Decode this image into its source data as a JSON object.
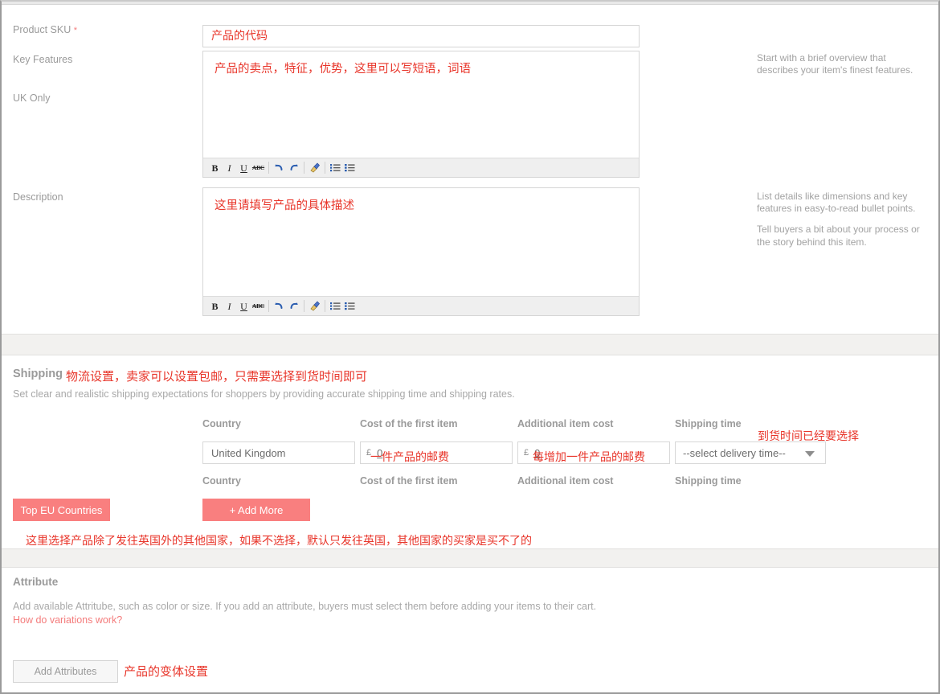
{
  "details": {
    "sku": {
      "label": "Product SKU",
      "required_mark": "*",
      "value": "",
      "placeholder": "产品的代码"
    },
    "key_features": {
      "label": "Key Features",
      "content": "产品的卖点，特征，优势，这里可以写短语，词语",
      "help": "Start with a brief overview that describes your item's finest features."
    },
    "description": {
      "label": "Description",
      "content": "这里请填写产品的具体描述",
      "help_1": "List details like dimensions and key features in easy-to-read bullet points.",
      "help_2": "Tell buyers a bit about your process or the story behind this item."
    },
    "toolbar": {
      "bold": "B",
      "italic": "I",
      "underline": "U",
      "strikethrough": "ABC",
      "undo": "↰",
      "redo": "↱",
      "format_painter": "brush",
      "bullet_list": "list",
      "numbered_list": "list"
    }
  },
  "shipping": {
    "title": "Shipping",
    "title_note": "物流设置，卖家可以设置包邮，只需要选择到货时间即可",
    "subtitle": "Set clear and realistic shipping expectations for shoppers by providing accurate shipping time and shipping rates.",
    "row_label": "UK Only",
    "columns": {
      "country": "Country",
      "first_cost": "Cost of the first item",
      "additional_cost": "Additional item cost",
      "shipping_time": "Shipping time"
    },
    "columns_2": {
      "country": "Country",
      "first_cost": "Cost of the first item",
      "additional_cost": "Additional item cost",
      "shipping_time": "Shipping time"
    },
    "values": {
      "country": "United Kingdom",
      "currency_symbol": "£",
      "first_cost": "0",
      "additional_cost": "0",
      "shipping_time": "--select delivery time--"
    },
    "buttons": {
      "top_eu": "Top EU Countries",
      "add_more": "+ Add More"
    },
    "notes": {
      "shipping_time": "到货时间已经要选择",
      "first_cost": "一件产品的邮费",
      "additional_cost": "每增加一件产品的邮费",
      "countries": "这里选择产品除了发往英国外的其他国家，如果不选择，默认只发往英国，其他国家的买家是买不了的"
    }
  },
  "attribute": {
    "title": "Attribute",
    "description": "Add available Attritube, such as color or size. If you add an attribute, buyers must select them before adding your items to their cart.",
    "link": "How do variations work?",
    "button": "Add Attributes",
    "note": "产品的变体设置"
  },
  "colors": {
    "accent_red": "#f97f7f",
    "annotation_red": "#e8352a",
    "label_gray": "#9a9a9a",
    "band_gray": "#f2f1ef"
  }
}
